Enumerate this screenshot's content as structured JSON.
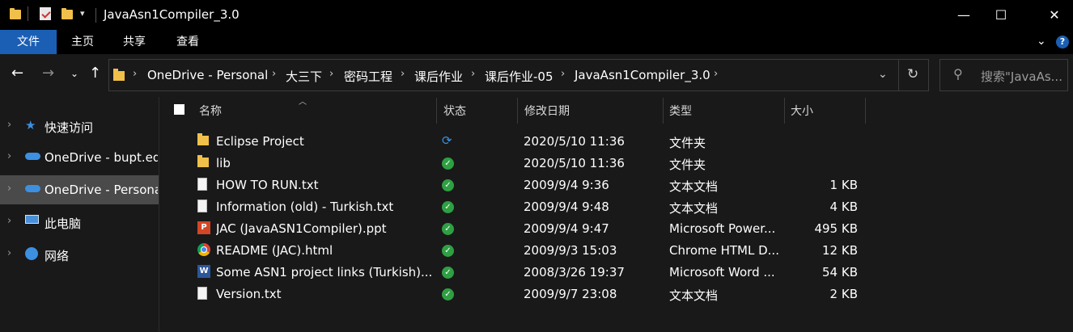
{
  "window": {
    "title": "JavaAsn1Compiler_3.0",
    "minimize_glyph": "—",
    "maximize_glyph": "☐",
    "close_glyph": "✕"
  },
  "ribbon": {
    "tabs": [
      {
        "label": "文件"
      },
      {
        "label": "主页"
      },
      {
        "label": "共享"
      },
      {
        "label": "查看"
      }
    ],
    "accent": "#1a5fb4"
  },
  "address": {
    "crumbs": [
      "OneDrive - Personal",
      "大三下",
      "密码工程",
      "课后作业",
      "课后作业-05",
      "JavaAsn1Compiler_3.0"
    ],
    "search_placeholder": "搜索\"JavaAs..."
  },
  "nav": {
    "items": [
      {
        "label": "快速访问",
        "icon": "star-icon"
      },
      {
        "label": "OneDrive - bupt.ed",
        "icon": "cloud-icon"
      },
      {
        "label": "OneDrive - Persona",
        "icon": "cloud-icon",
        "selected": true
      },
      {
        "label": "此电脑",
        "icon": "computer-icon"
      },
      {
        "label": "网络",
        "icon": "network-icon"
      }
    ]
  },
  "columns": {
    "name": "名称",
    "status": "状态",
    "date": "修改日期",
    "type": "类型",
    "size": "大小"
  },
  "files": [
    {
      "name": "Eclipse Project",
      "status": "syncing",
      "date": "2020/5/10 11:36",
      "type": "文件夹",
      "size": "",
      "icon": "folder-icon"
    },
    {
      "name": "lib",
      "status": "ok",
      "date": "2020/5/10 11:36",
      "type": "文件夹",
      "size": "",
      "icon": "folder-icon"
    },
    {
      "name": "HOW TO RUN.txt",
      "status": "ok",
      "date": "2009/9/4 9:36",
      "type": "文本文档",
      "size": "1 KB",
      "icon": "text-file-icon"
    },
    {
      "name": "Information (old) - Turkish.txt",
      "status": "ok",
      "date": "2009/9/4 9:48",
      "type": "文本文档",
      "size": "4 KB",
      "icon": "text-file-icon"
    },
    {
      "name": "JAC (JavaASN1Compiler).ppt",
      "status": "ok",
      "date": "2009/9/4 9:47",
      "type": "Microsoft Power...",
      "size": "495 KB",
      "icon": "powerpoint-icon"
    },
    {
      "name": "README (JAC).html",
      "status": "ok",
      "date": "2009/9/3 15:03",
      "type": "Chrome HTML D...",
      "size": "12 KB",
      "icon": "chrome-icon"
    },
    {
      "name": "Some ASN1 project links (Turkish)....",
      "status": "ok",
      "date": "2008/3/26 19:37",
      "type": "Microsoft Word ...",
      "size": "54 KB",
      "icon": "word-icon"
    },
    {
      "name": "Version.txt",
      "status": "ok",
      "date": "2009/9/7 23:08",
      "type": "文本文档",
      "size": "2 KB",
      "icon": "text-file-icon"
    }
  ]
}
